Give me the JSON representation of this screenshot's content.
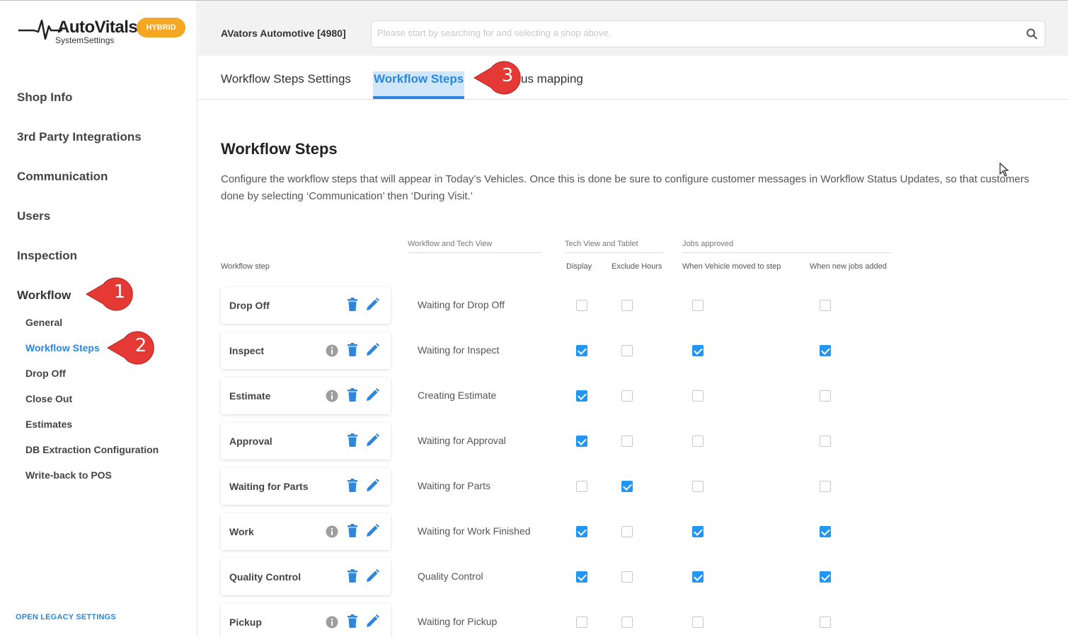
{
  "logo": {
    "brand": "AutoVitals",
    "sub": "SystemSettings",
    "badge": "HYBRID"
  },
  "sidebar": {
    "main": [
      {
        "label": "Shop Info"
      },
      {
        "label": "3rd Party Integrations"
      },
      {
        "label": "Communication"
      },
      {
        "label": "Users"
      },
      {
        "label": "Inspection"
      },
      {
        "label": "Workflow"
      }
    ],
    "sub": [
      {
        "label": "General"
      },
      {
        "label": "Workflow Steps"
      },
      {
        "label": "Drop Off"
      },
      {
        "label": "Close Out"
      },
      {
        "label": "Estimates"
      },
      {
        "label": "DB Extraction Configuration"
      },
      {
        "label": "Write-back to POS"
      }
    ],
    "legacy": "OPEN LEGACY SETTINGS"
  },
  "header": {
    "shop": "AVators Automotive [4980]",
    "search_placeholder": "Please start by searching for and selecting a shop above."
  },
  "tabs": [
    {
      "label": "Workflow Steps Settings"
    },
    {
      "label": "Workflow Steps"
    },
    {
      "label": "us mapping"
    }
  ],
  "main": {
    "title": "Workflow Steps",
    "desc_line1": "Configure the workflow steps that will appear in Today’s Vehicles. Once this is done be sure to configure customer messages in Workflow Status Updates, so that customers",
    "desc_line2": "done by selecting ‘Communication’ then ‘During Visit.’",
    "groups": {
      "workflow_tech": "Workflow and Tech View",
      "tech_tablet": "Tech View and Tablet",
      "jobs": "Jobs approved"
    },
    "columns": {
      "step": "Workflow step",
      "display": "Display",
      "exclude": "Exclude Hours",
      "moved": "When Vehicle moved to step",
      "newjobs": "When new jobs added"
    },
    "rows": [
      {
        "step": "Drop Off",
        "tech": "Waiting for Drop Off",
        "info": false,
        "display": false,
        "exclude": false,
        "moved": false,
        "newjobs": false
      },
      {
        "step": "Inspect",
        "tech": "Waiting for Inspect",
        "info": true,
        "display": true,
        "exclude": false,
        "moved": true,
        "newjobs": true
      },
      {
        "step": "Estimate",
        "tech": "Creating Estimate",
        "info": true,
        "display": true,
        "exclude": false,
        "moved": false,
        "newjobs": false
      },
      {
        "step": "Approval",
        "tech": "Waiting for Approval",
        "info": false,
        "display": true,
        "exclude": false,
        "moved": false,
        "newjobs": false
      },
      {
        "step": "Waiting for Parts",
        "tech": "Waiting for Parts",
        "info": false,
        "display": false,
        "exclude": true,
        "moved": false,
        "newjobs": false
      },
      {
        "step": "Work",
        "tech": "Waiting for Work Finished",
        "info": true,
        "display": true,
        "exclude": false,
        "moved": true,
        "newjobs": true
      },
      {
        "step": "Quality Control",
        "tech": "Quality Control",
        "info": false,
        "display": true,
        "exclude": false,
        "moved": true,
        "newjobs": true
      },
      {
        "step": "Pickup",
        "tech": "Waiting for Pickup",
        "info": true,
        "display": false,
        "exclude": false,
        "moved": false,
        "newjobs": false
      }
    ]
  },
  "callouts": [
    "1",
    "2",
    "3"
  ],
  "colors": {
    "accent": "#2b87e0",
    "checkbox": "#2196f3",
    "badge": "#f5a623",
    "callout": "#e53935"
  }
}
